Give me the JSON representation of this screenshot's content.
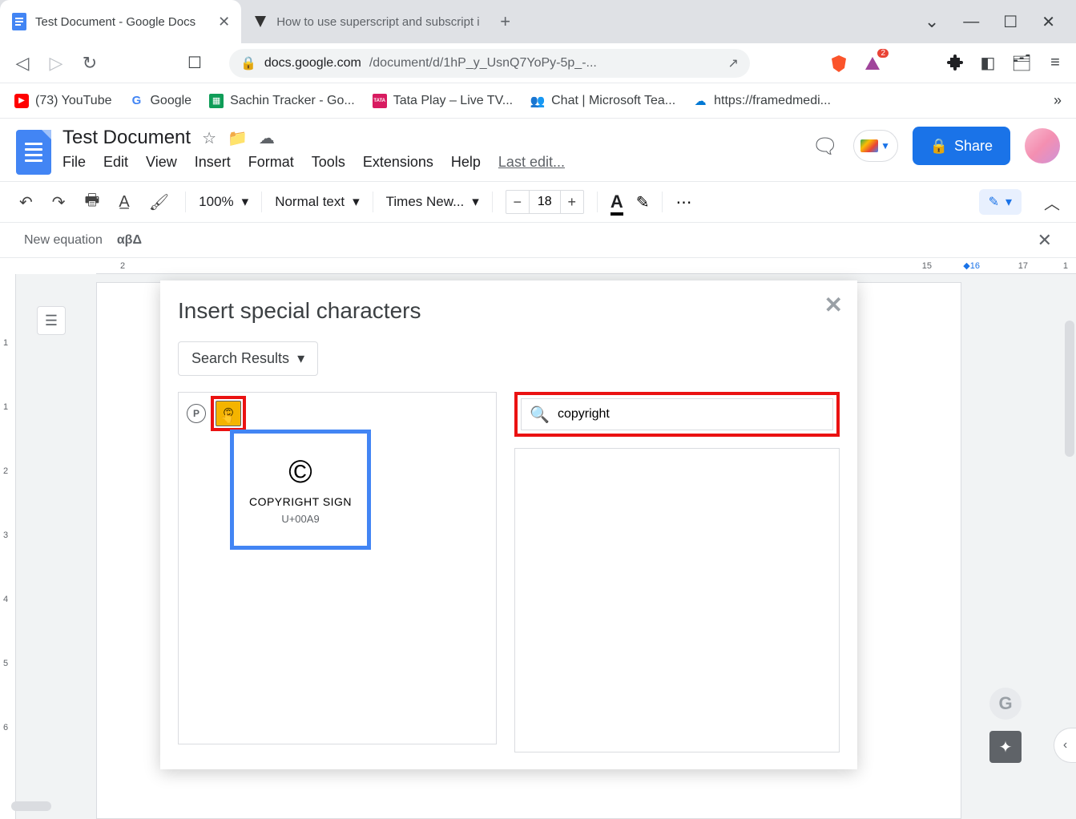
{
  "browser": {
    "tabs": [
      {
        "title": "Test Document - Google Docs",
        "active": true
      },
      {
        "title": "How to use superscript and subscript i",
        "active": false
      }
    ],
    "url_host": "docs.google.com",
    "url_path": "/document/d/1hP_y_UsnQ7YoPy-5p_-...",
    "extension_badge": "2"
  },
  "bookmarks": [
    {
      "label": "(73) YouTube",
      "color": "#ff0000",
      "glyph": "▶"
    },
    {
      "label": "Google",
      "color": "#4285f4",
      "glyph": "G"
    },
    {
      "label": "Sachin Tracker - Go...",
      "color": "#0f9d58",
      "glyph": "▦"
    },
    {
      "label": "Tata Play – Live TV...",
      "color": "#d81b60",
      "glyph": "TATA"
    },
    {
      "label": "Chat | Microsoft Tea...",
      "color": "#5558af",
      "glyph": "👥"
    },
    {
      "label": "https://framedmedi...",
      "color": "#0078d4",
      "glyph": "☁"
    }
  ],
  "docs": {
    "title": "Test Document",
    "menus": [
      "File",
      "Edit",
      "View",
      "Insert",
      "Format",
      "Tools",
      "Extensions",
      "Help"
    ],
    "last_edit": "Last edit...",
    "share": "Share"
  },
  "toolbar": {
    "zoom": "100%",
    "style": "Normal text",
    "font": "Times New...",
    "size": "18"
  },
  "equation": {
    "label": "New equation",
    "groups": "αβΔ"
  },
  "ruler": {
    "h_left": "2",
    "h_right": [
      "15",
      "16",
      "17",
      "1"
    ]
  },
  "dialog": {
    "title": "Insert special characters",
    "filter": "Search Results",
    "results": {
      "p_glyph": "P",
      "c_glyph": "©"
    },
    "tooltip": {
      "symbol": "©",
      "name": "COPYRIGHT SIGN",
      "code": "U+00A9"
    },
    "search_value": "copyright"
  }
}
